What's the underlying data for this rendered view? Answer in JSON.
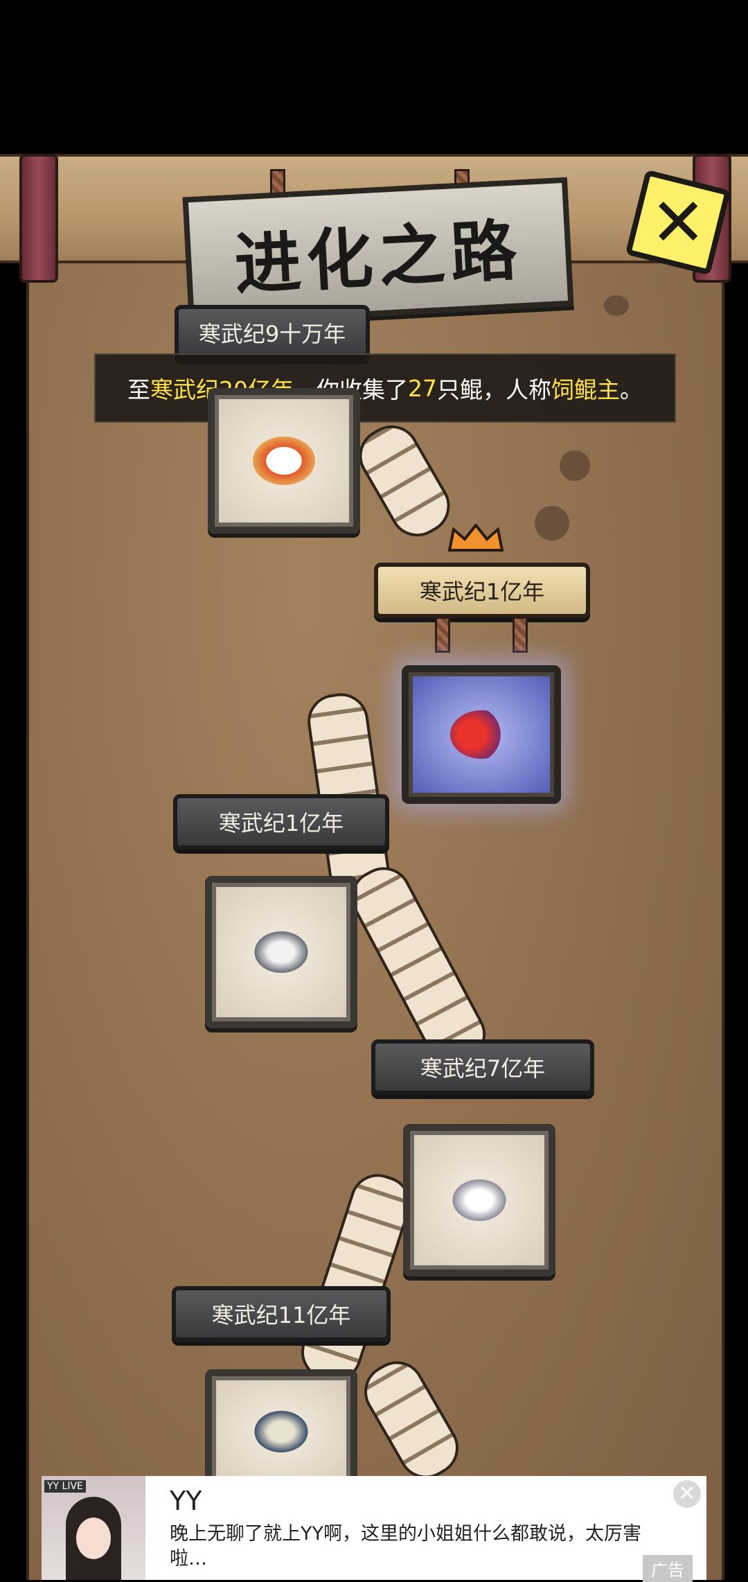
{
  "title": "进化之路",
  "close_symbol": "✕",
  "summary": {
    "prefix": "至",
    "era": "寒武纪20亿年",
    "mid": "，你收集了",
    "count": "27",
    "unit": "只鲲，人称",
    "rank": "饲鲲主",
    "suffix": "。"
  },
  "stages": [
    {
      "era": "寒武纪9十万年",
      "creature": "round-cartoon-creature-icon"
    },
    {
      "era": "寒武纪1亿年",
      "creature": "red-winged-fish-icon",
      "active": true
    },
    {
      "era": "寒武纪1亿年",
      "creature": "grey-horned-creature-icon"
    },
    {
      "era": "寒武纪7亿年",
      "creature": "grey-shark-icon"
    },
    {
      "era": "寒武纪11亿年",
      "creature": "horned-fish-icon"
    }
  ],
  "ad": {
    "brand": "YY LIVE",
    "title": "YY",
    "description": "晚上无聊了就上YY啊，这里的小姐姐什么都敢说，太厉害啦…",
    "close": "✕",
    "label": "广告"
  },
  "colors": {
    "highlight": "#ffe24a",
    "parchment": "#9a7a58",
    "active_frame": "#4f58b4"
  }
}
